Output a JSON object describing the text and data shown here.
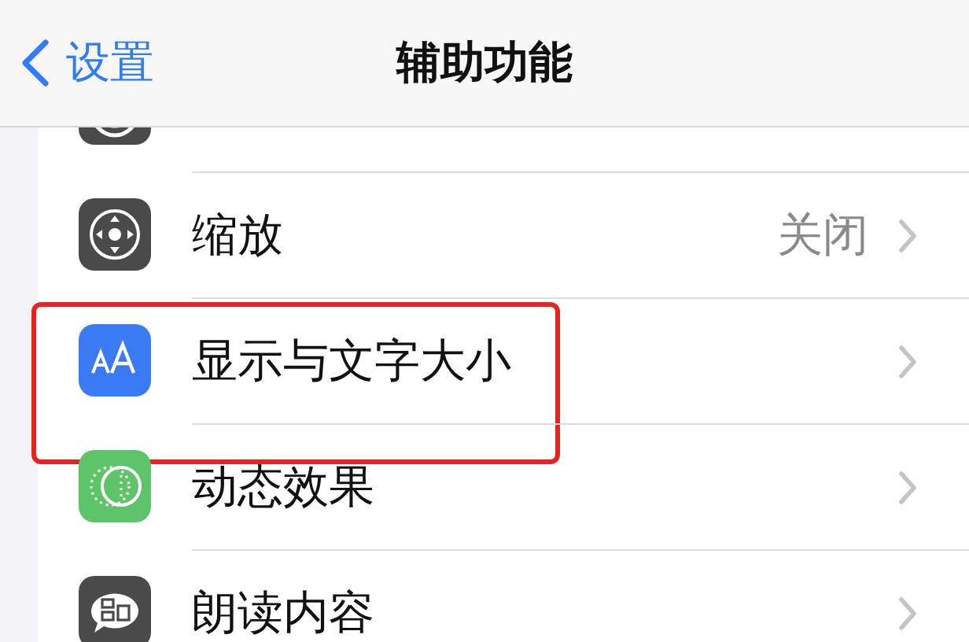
{
  "nav": {
    "back_label": "设置",
    "title": "辅助功能"
  },
  "rows": [
    {
      "kind": "voiceover",
      "color": "#4a4a4a",
      "highlighted": false
    },
    {
      "kind": "zoom",
      "color": "#4a4a4a",
      "label": "缩放",
      "value": "关闭",
      "highlighted": false
    },
    {
      "kind": "text-size",
      "color": "#3a7af3",
      "label": "显示与文字大小",
      "highlighted": true
    },
    {
      "kind": "motion",
      "color": "#5ec46a",
      "label": "动态效果",
      "highlighted": false
    },
    {
      "kind": "speech",
      "color": "#4a4a4a",
      "label": "朗读内容",
      "highlighted": false
    }
  ]
}
